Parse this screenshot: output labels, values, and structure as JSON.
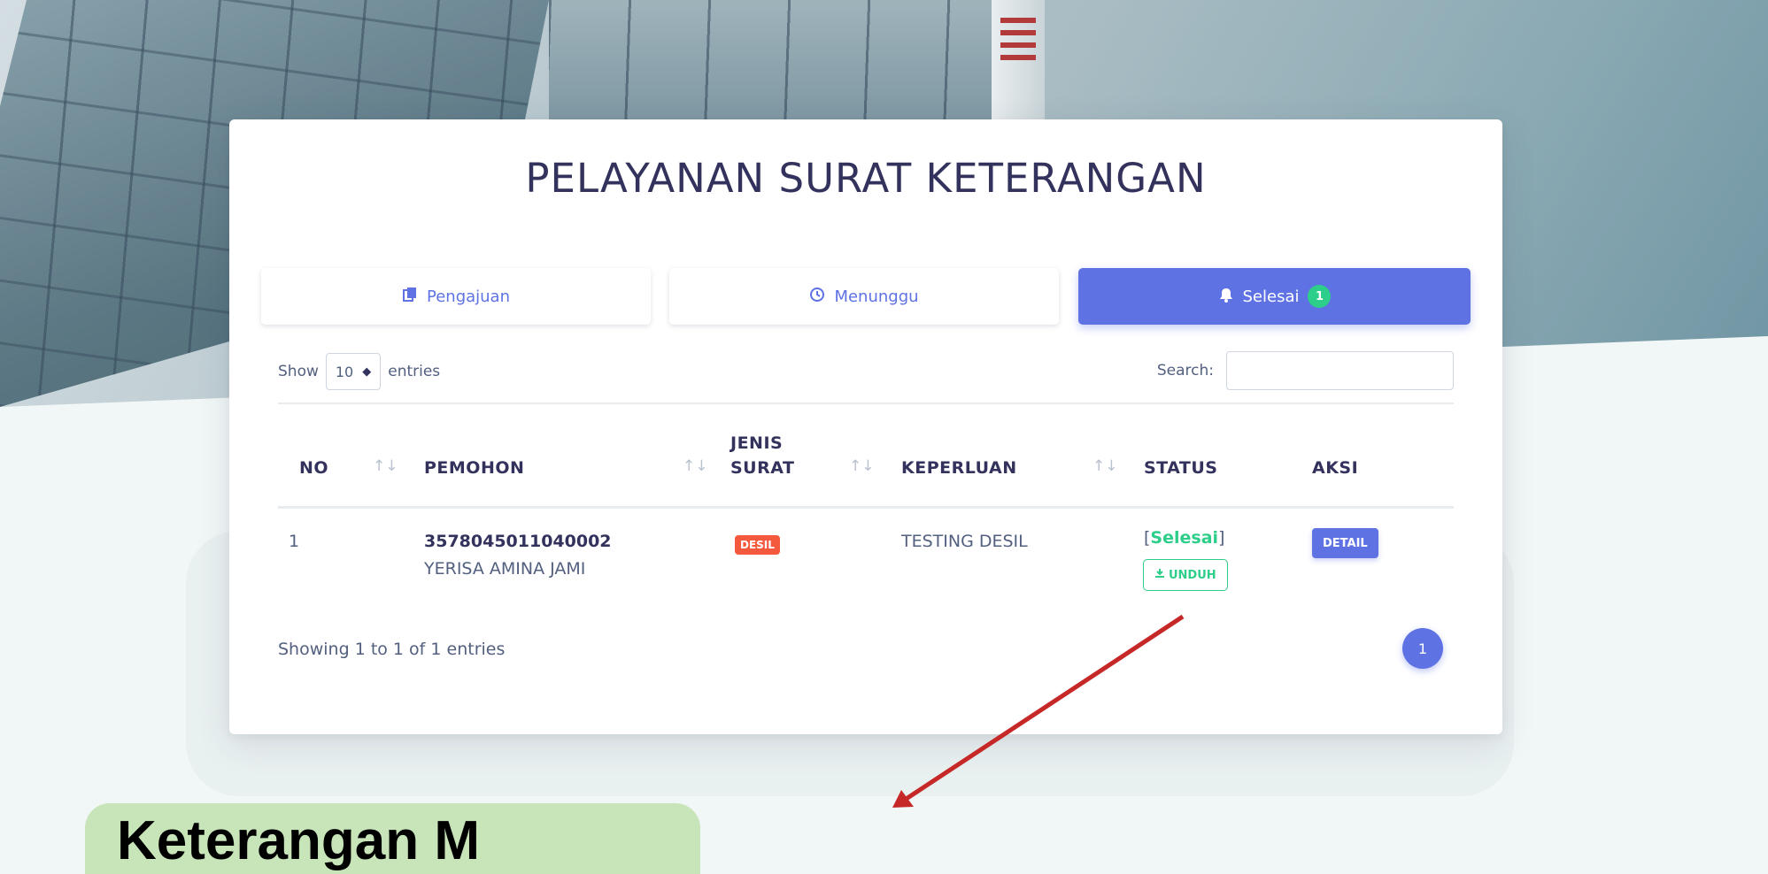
{
  "page": {
    "title": "PELAYANAN SURAT KETERANGAN"
  },
  "tabs": [
    {
      "label": "Pengajuan",
      "icon": "document-copy-icon",
      "active": false
    },
    {
      "label": "Menunggu",
      "icon": "clock-icon",
      "active": false
    },
    {
      "label": "Selesai",
      "icon": "bell-icon",
      "active": true,
      "count": "1"
    }
  ],
  "table_controls": {
    "show_label": "Show",
    "entries_value": "10",
    "entries_label": "entries",
    "search_label": "Search:",
    "search_value": ""
  },
  "table": {
    "headers": [
      {
        "label": "NO",
        "sortable": true
      },
      {
        "label": "PEMOHON",
        "sortable": true
      },
      {
        "label_line1": "JENIS",
        "label_line2": "SURAT",
        "sortable": true
      },
      {
        "label": "KEPERLUAN",
        "sortable": true
      },
      {
        "label": "STATUS",
        "sortable": false
      },
      {
        "label": "AKSI",
        "sortable": false
      }
    ],
    "rows": [
      {
        "no": "1",
        "nik": "3578045011040002",
        "nama": "YERISA AMINA JAMI",
        "jenis_surat": "DESIL",
        "keperluan": "TESTING DESIL",
        "status": "Selesai",
        "unduh_label": "UNDUH",
        "aksi_label": "DETAIL"
      }
    ]
  },
  "pagination": {
    "info": "Showing 1 to 1 of 1 entries",
    "current_page": "1"
  },
  "annotation": {
    "text": "Keterangan M"
  },
  "colors": {
    "primary": "#5e72e4",
    "success": "#2dce89",
    "danger": "#f5593d",
    "heading": "#32325d",
    "note_bg": "#c7e5b8",
    "arrow": "#c62828"
  }
}
